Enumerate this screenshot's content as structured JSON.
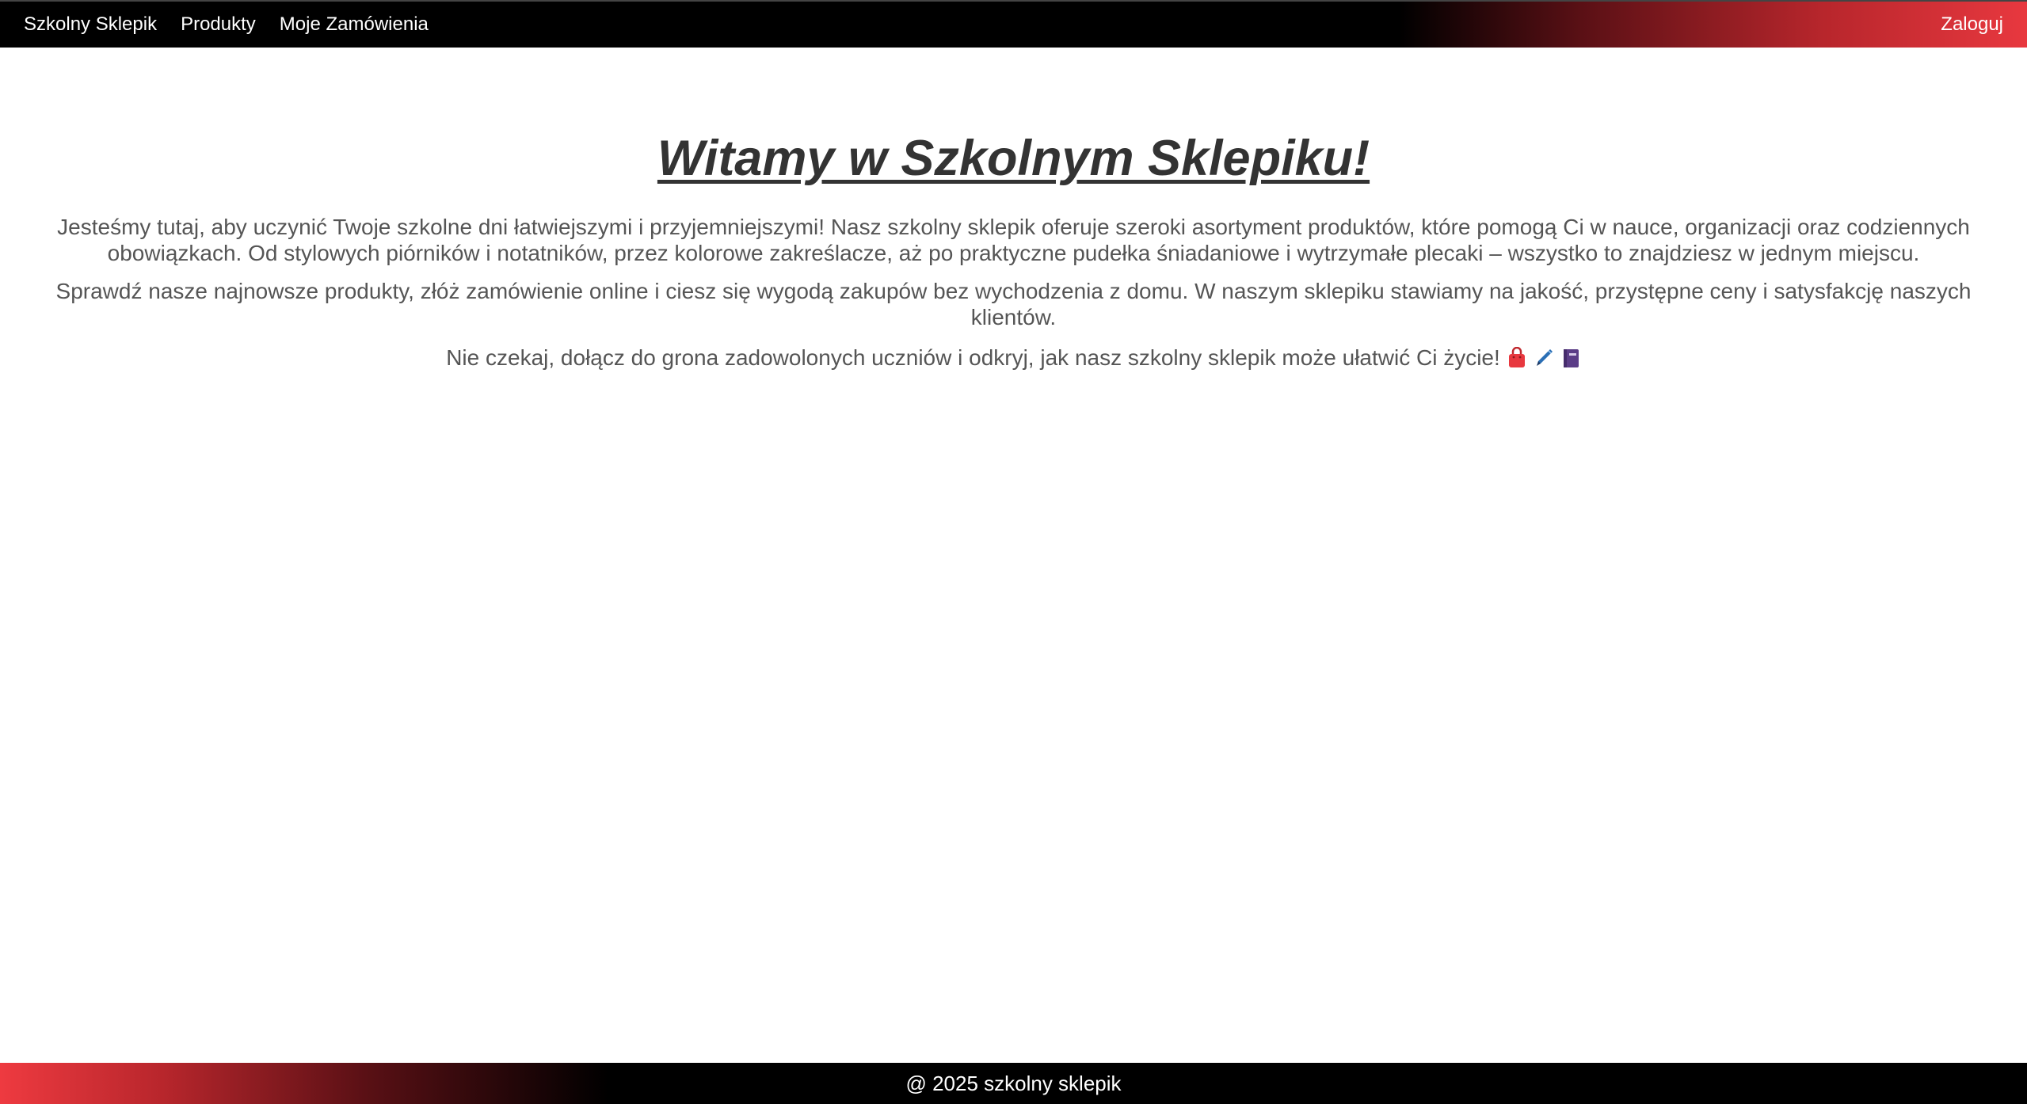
{
  "nav": {
    "brand": "Szkolny Sklepik",
    "products": "Produkty",
    "orders": "Moje Zamówienia",
    "login": "Zaloguj"
  },
  "main": {
    "title": "Witamy w Szkolnym Sklepiku!",
    "paragraph1": "Jesteśmy tutaj, aby uczynić Twoje szkolne dni łatwiejszymi i przyjemniejszymi! Nasz szkolny sklepik oferuje szeroki asortyment produktów, które pomogą Ci w nauce, organizacji oraz codziennych obowiązkach. Od stylowych piórników i notatników, przez kolorowe zakreślacze, aż po praktyczne pudełka śniadaniowe i wytrzymałe plecaki – wszystko to znajdziesz w jednym miejscu.",
    "paragraph2": "Sprawdź nasze najnowsze produkty, złóż zamówienie online i ciesz się wygodą zakupów bez wychodzenia z domu. W naszym sklepiku stawiamy na jakość, przystępne ceny i satysfakcję naszych klientów.",
    "paragraph3": "Nie czekaj, dołącz do grona zadowolonych uczniów i odkryj, jak nasz szkolny sklepik może ułatwić Ci życie!",
    "emojis": [
      "shopping-bag-icon",
      "pen-icon",
      "notebook-icon"
    ]
  },
  "footer": {
    "text": "@ 2025 szkolny sklepik"
  },
  "colors": {
    "nav_bg": "#000000",
    "accent_red": "#e8383f",
    "heading": "#333333",
    "body_text": "#555555"
  }
}
